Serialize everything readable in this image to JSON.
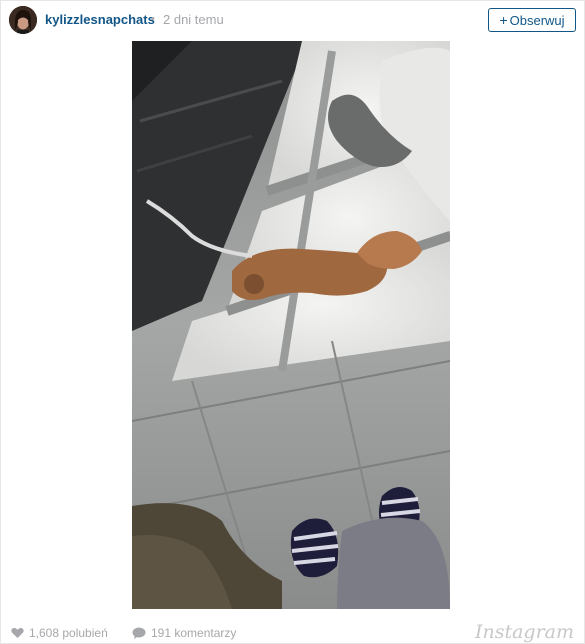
{
  "header": {
    "username": "kylizzlesnapchats",
    "separator": "•",
    "timestamp": "2 dni temu",
    "follow_plus": "+",
    "follow_label": "Obserwuj"
  },
  "media": {
    "type": "video-frame",
    "subject": "cat-in-sunlight"
  },
  "footer": {
    "likes": "1,608 polubień",
    "comments": "191 komentarzy",
    "brand": "Instagram"
  },
  "colors": {
    "link": "#125688",
    "muted": "#a5a7aa",
    "border": "#e6e6e6"
  },
  "icons": {
    "likes": "heart-icon",
    "comments": "speech-bubble-icon"
  }
}
